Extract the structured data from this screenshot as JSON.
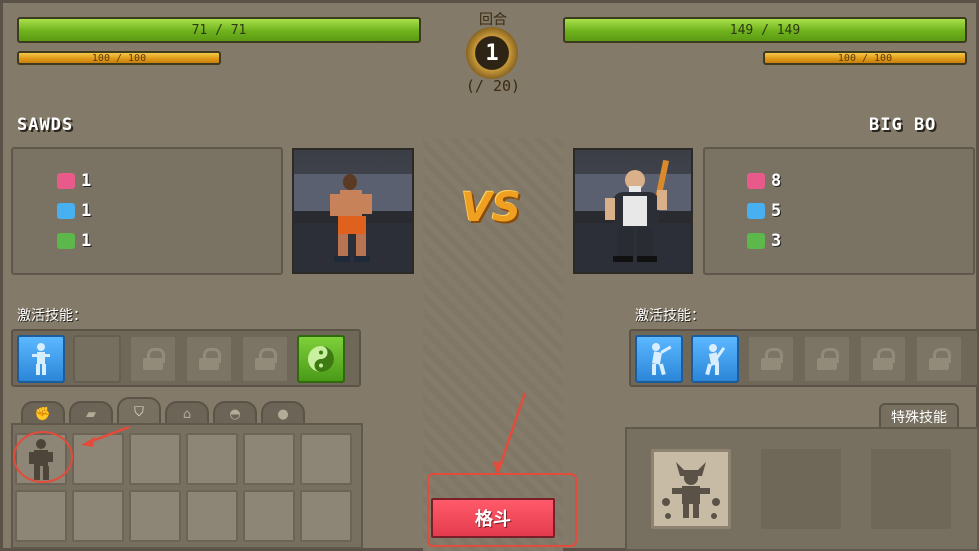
{
  "hud": {
    "round_label": "回合",
    "round_current": "1",
    "round_max": "(/ 20)"
  },
  "player": {
    "name": "SAWDS",
    "hp_text": "71 / 71",
    "hp_fraction": 1.0,
    "mp_text": "100 / 100",
    "mp_fraction": 1.0,
    "stats": [
      {
        "icon": "weight-icon",
        "color": "#e85a8a",
        "value": "1"
      },
      {
        "icon": "agility-icon",
        "color": "#48b0f0",
        "value": "1"
      },
      {
        "icon": "money-icon",
        "color": "#5cb84a",
        "value": "1"
      }
    ],
    "skills_label": "激活技能：",
    "skills": [
      {
        "type": "active-blue",
        "icon": "fighter-stance-icon"
      },
      {
        "type": "empty"
      },
      {
        "type": "locked",
        "icon": "lock-icon"
      },
      {
        "type": "locked",
        "icon": "lock-icon"
      },
      {
        "type": "locked",
        "icon": "lock-icon"
      },
      {
        "type": "active-green",
        "icon": "yin-yang-icon"
      }
    ]
  },
  "opponent": {
    "name": "BIG BO",
    "hp_text": "149 / 149",
    "hp_fraction": 1.0,
    "mp_text": "100 / 100",
    "mp_fraction": 1.0,
    "stats": [
      {
        "icon": "weight-icon",
        "color": "#e85a8a",
        "value": "8"
      },
      {
        "icon": "agility-icon",
        "color": "#48b0f0",
        "value": "5"
      },
      {
        "icon": "money-icon",
        "color": "#5cb84a",
        "value": "3"
      }
    ],
    "skills_label": "激活技能：",
    "skills": [
      {
        "type": "active-blue",
        "icon": "punch-icon"
      },
      {
        "type": "active-blue",
        "icon": "bat-swing-icon"
      },
      {
        "type": "locked",
        "icon": "lock-icon"
      },
      {
        "type": "locked",
        "icon": "lock-icon"
      },
      {
        "type": "locked",
        "icon": "lock-icon"
      },
      {
        "type": "locked",
        "icon": "lock-icon"
      }
    ]
  },
  "vs_text": "VS",
  "inventory": {
    "tabs": [
      {
        "icon": "glove-icon",
        "glyph": "✊"
      },
      {
        "icon": "shoe-icon",
        "glyph": "▰"
      },
      {
        "icon": "shorts-icon",
        "glyph": "⛉"
      },
      {
        "icon": "shirt-icon",
        "glyph": "⌂"
      },
      {
        "icon": "mask-icon",
        "glyph": "◓"
      },
      {
        "icon": "ball-icon",
        "glyph": "●"
      }
    ],
    "selected_tab_index": 2,
    "first_slot_item": "fighter-silhouette-icon"
  },
  "fight_button_label": "格斗",
  "special_skills_label": "特殊技能",
  "special_skills": [
    {
      "filled": true,
      "icon": "warrior-emblem-icon"
    },
    {
      "filled": false
    },
    {
      "filled": false
    }
  ],
  "colors": {
    "annotation": "#e34b3a",
    "hp": "#7bc22a",
    "mp": "#e8a822",
    "fight_button": "#f0485a",
    "skill_blue": "#3a9ae8",
    "skill_green": "#5aac24"
  }
}
